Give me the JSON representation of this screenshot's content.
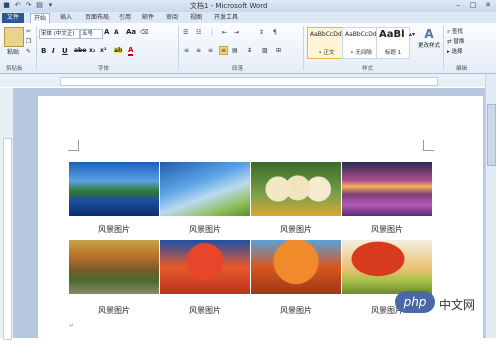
{
  "window": {
    "title": "文档1 - Microsoft Word",
    "quick_access": [
      "save-icon",
      "undo-icon",
      "redo-icon",
      "print-preview-icon",
      "customize-icon"
    ],
    "controls": [
      "minimize-icon",
      "restore-icon",
      "close-icon"
    ]
  },
  "tabs": [
    "文件",
    "开始",
    "插入",
    "页面布局",
    "引用",
    "邮件",
    "审阅",
    "视图",
    "开发工具"
  ],
  "ribbon": {
    "clipboard": {
      "paste": "粘贴",
      "label": "剪贴板"
    },
    "font": {
      "name": "宋体 (中文正)",
      "size": "五号",
      "grow": "A",
      "shrink": "A",
      "aa": "Aa",
      "bold": "B",
      "italic": "I",
      "underline": "U",
      "strike": "abe",
      "sub": "x₂",
      "sup": "x²",
      "highlight": "ab",
      "color": "A",
      "label": "字体"
    },
    "paragraph": {
      "label": "段落"
    },
    "styles": {
      "items": [
        {
          "sample": "AaBbCcDd",
          "name": "• 正文"
        },
        {
          "sample": "AaBbCcDd",
          "name": "• 无间隔"
        },
        {
          "sample": "AaBl",
          "name": "标题 1"
        }
      ],
      "change": "更改样式",
      "label": "样式"
    },
    "editing": {
      "find": "查找",
      "replace": "替换",
      "select": "选择",
      "label": "编辑"
    }
  },
  "document": {
    "captions": [
      "风景图片",
      "风景图片",
      "风景图片",
      "风景图片",
      "风景图片",
      "风景图片",
      "风景图片",
      "风景图片"
    ],
    "para_mark": "↵"
  },
  "watermark": {
    "logo": "php",
    "text": "中文网"
  }
}
